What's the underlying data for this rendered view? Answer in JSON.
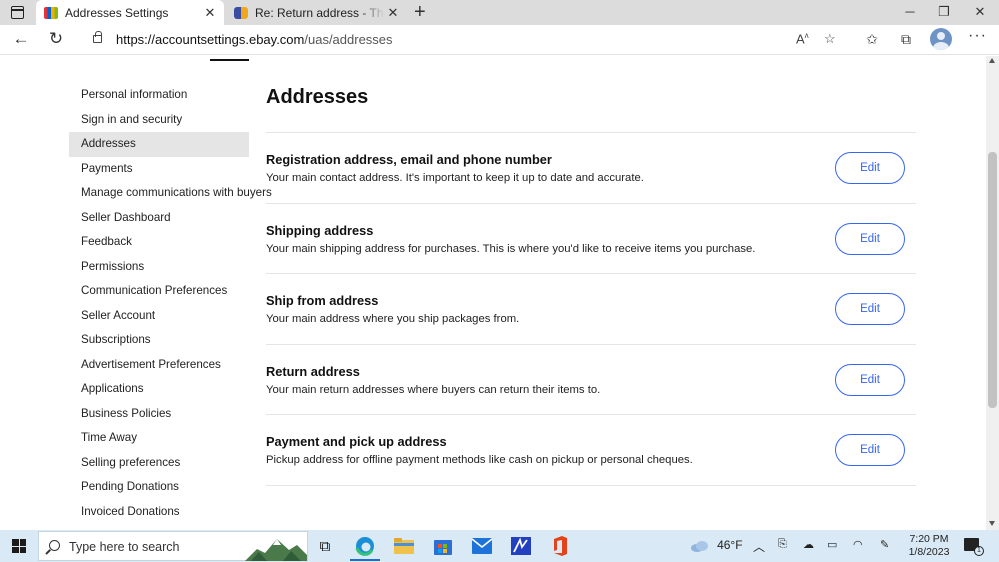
{
  "browser": {
    "tabs": [
      {
        "title": "Addresses Settings",
        "active": true
      },
      {
        "title": "Re: Return address - The eBay Co",
        "active": false
      }
    ],
    "url_domain": "https://accountsettings.ebay.com",
    "url_path": "/uas/addresses"
  },
  "sidebar": {
    "items": [
      {
        "label": "Personal information"
      },
      {
        "label": "Sign in and security"
      },
      {
        "label": "Addresses",
        "selected": true
      },
      {
        "label": "Payments"
      },
      {
        "label": "Manage communications with buyers"
      },
      {
        "label": "Seller Dashboard"
      },
      {
        "label": "Feedback"
      },
      {
        "label": "Permissions"
      },
      {
        "label": "Communication Preferences"
      },
      {
        "label": "Seller Account"
      },
      {
        "label": "Subscriptions"
      },
      {
        "label": "Advertisement Preferences"
      },
      {
        "label": "Applications"
      },
      {
        "label": "Business Policies"
      },
      {
        "label": "Time Away"
      },
      {
        "label": "Selling preferences"
      },
      {
        "label": "Pending Donations"
      },
      {
        "label": "Invoiced Donations"
      }
    ]
  },
  "main": {
    "title": "Addresses",
    "sections": [
      {
        "title": "Registration address, email and phone number",
        "description": "Your main contact address. It's important to keep it up to date and accurate.",
        "button": "Edit"
      },
      {
        "title": "Shipping address",
        "description": "Your main shipping address for purchases. This is where you'd like to receive items you purchase.",
        "button": "Edit"
      },
      {
        "title": "Ship from address",
        "description": "Your main address where you ship packages from.",
        "button": "Edit"
      },
      {
        "title": "Return address",
        "description": "Your main return addresses where buyers can return their items to.",
        "button": "Edit"
      },
      {
        "title": "Payment and pick up address",
        "description": "Pickup address for offline payment methods like cash on pickup or personal cheques.",
        "button": "Edit"
      }
    ]
  },
  "taskbar": {
    "search_placeholder": "Type here to search",
    "weather": "46°F",
    "time": "7:20 PM",
    "date": "1/8/2023",
    "notification_count": "1"
  },
  "colors": {
    "accent": "#3665f3",
    "taskbar": "#d9e9f5",
    "selected_nav": "#e5e5e5"
  }
}
